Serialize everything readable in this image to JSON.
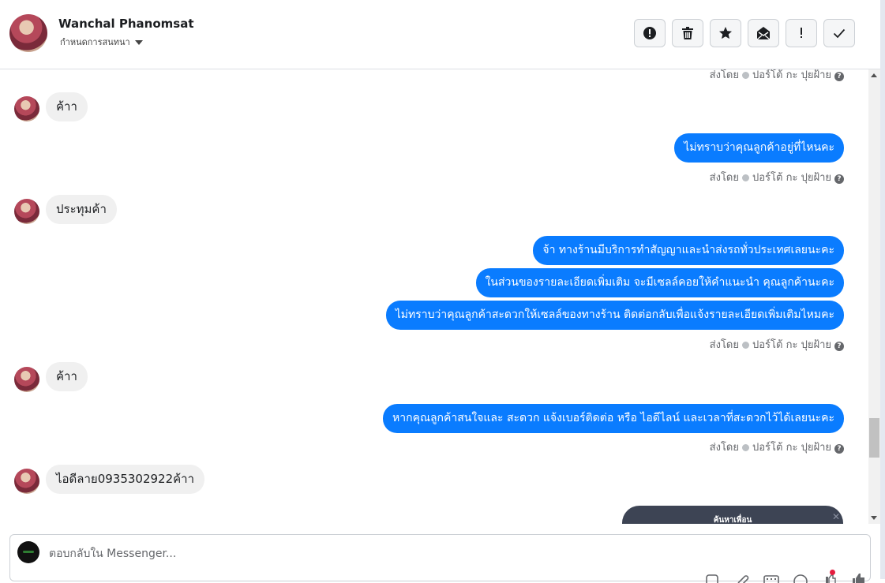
{
  "header": {
    "contact_name": "Wanchal Phanomsat",
    "subtitle": "กำหนดการสนทนา",
    "actions": [
      {
        "name": "spam-button",
        "icon": "alert-circle-icon"
      },
      {
        "name": "delete-button",
        "icon": "trash-icon"
      },
      {
        "name": "star-button",
        "icon": "star-icon"
      },
      {
        "name": "mark-unread-button",
        "icon": "envelope-open-icon"
      },
      {
        "name": "important-button",
        "icon": "exclamation-icon"
      },
      {
        "name": "mark-done-button",
        "icon": "checkmark-icon"
      }
    ]
  },
  "conversation": {
    "sent_by_label": "ส่งโดย",
    "sent_by_name": "ปอร์โต้ กะ ปุยฝ้าย",
    "messages": [
      {
        "dir": "meta"
      },
      {
        "dir": "in",
        "text": "ค้าา"
      },
      {
        "dir": "out",
        "text": "ไม่ทราบว่าคุณลูกค้าอยู่ที่ไหนคะ"
      },
      {
        "dir": "meta"
      },
      {
        "dir": "in",
        "text": "ประทุมค้า"
      },
      {
        "dir": "out",
        "text": "จ้า ทางร้านมีบริการทำสัญญาและนำส่งรถทั่วประเทศเลยนะคะ"
      },
      {
        "dir": "out",
        "text": "ในส่วนของรายละเอียดเพิ่มเติม จะมีเซลล์คอยให้คำแนะนำ คุณลูกค้านะคะ"
      },
      {
        "dir": "out",
        "text": "ไม่ทราบว่าคุณลูกค้าสะดวกให้เซลล์ของทางร้าน ติดต่อกลับเพื่อแจ้งรายละเอียดเพิ่มเติมไหมคะ"
      },
      {
        "dir": "meta"
      },
      {
        "dir": "in",
        "text": "ค้าา"
      },
      {
        "dir": "out",
        "text": "หากคุณลูกค้าสนใจและ สะดวก แจ้งเบอร์ติดต่อ หรือ ไอดีไลน์ และเวลาที่สะดวกไว้ได้เลยนะคะ"
      },
      {
        "dir": "meta"
      },
      {
        "dir": "in",
        "text": "ไอดีลาย0935302922ค้าา"
      }
    ],
    "card_title": "ค้นหาเพื่อน"
  },
  "composer": {
    "placeholder": "ตอบกลับใน Messenger...",
    "tool_icons": [
      "attach-icon",
      "paperclip-icon",
      "keyboard-icon",
      "emoji-icon",
      "like-icon",
      "thumbs-up-icon"
    ]
  }
}
